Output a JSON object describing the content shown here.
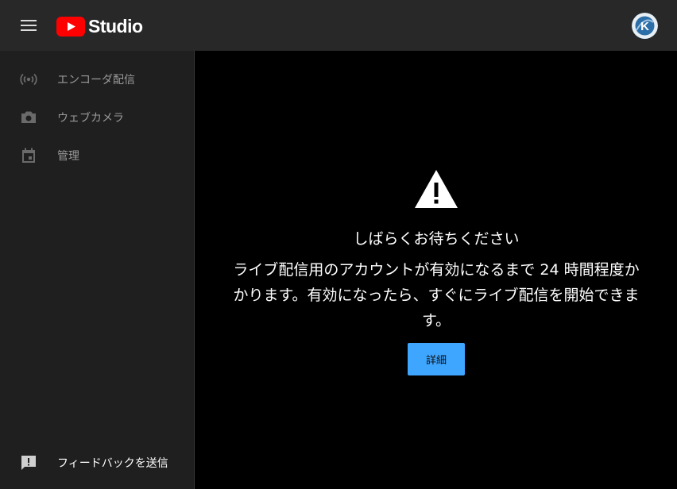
{
  "header": {
    "brand": "Studio",
    "menu_icon": "hamburger-menu-icon",
    "logo_icon": "youtube-play-icon",
    "logo_color": "#ff0000",
    "avatar_icon": "k-avatar-icon",
    "avatar_letter": "K"
  },
  "sidebar": {
    "items": [
      {
        "label": "エンコーダ配信",
        "icon": "broadcast-icon"
      },
      {
        "label": "ウェブカメラ",
        "icon": "camera-icon"
      },
      {
        "label": "管理",
        "icon": "calendar-icon"
      }
    ],
    "feedback": {
      "label": "フィードバックを送信",
      "icon": "feedback-icon"
    }
  },
  "main": {
    "warning_icon": "warning-icon",
    "title": "しばらくお待ちください",
    "message": "ライブ配信用のアカウントが有効になるまで 24 時間程度かかります。有効になったら、すぐにライブ配信を開始できます。",
    "details_button": "詳細",
    "accent": "#3ea6ff"
  }
}
